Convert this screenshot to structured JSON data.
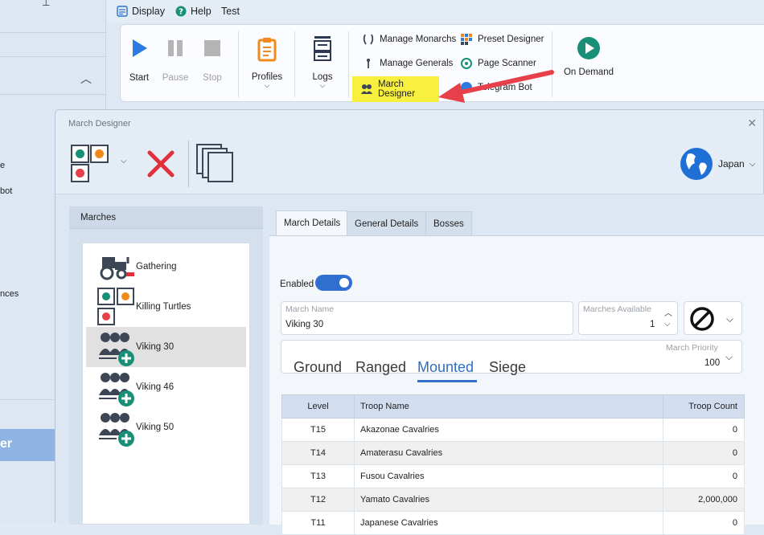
{
  "menu": {
    "display_label": "Display",
    "help_label": "Help",
    "test_label": "Test"
  },
  "ribbon": {
    "start_label": "Start",
    "pause_label": "Pause",
    "stop_label": "Stop",
    "profiles_label": "Profiles",
    "logs_label": "Logs",
    "manage_monarchs_label": "Manage Monarchs",
    "manage_generals_label": "Manage Generals",
    "march_designer_label": "March Designer",
    "preset_designer_label": "Preset Designer",
    "page_scanner_label": "Page Scanner",
    "telegram_bot_label": "Telegram Bot",
    "on_demand_label": "On Demand"
  },
  "left_pane": {
    "fragments": [
      "e",
      "bot",
      "nces"
    ],
    "selected_fragment": "er"
  },
  "dialog": {
    "title": "March Designer",
    "server_label": "Japan"
  },
  "marches": {
    "header": "Marches",
    "items": [
      {
        "label": "Gathering",
        "icon": "tractor-icon"
      },
      {
        "label": "Killing Turtles",
        "icon": "traffic-dots-icon"
      },
      {
        "label": "Viking 30",
        "icon": "troops-add-icon"
      },
      {
        "label": "Viking 46",
        "icon": "troops-add-icon"
      },
      {
        "label": "Viking 50",
        "icon": "troops-add-icon"
      }
    ]
  },
  "details": {
    "tabs": [
      "March Details",
      "General Details",
      "Bosses"
    ],
    "enabled_label": "Enabled",
    "march_name_label": "March Name",
    "march_name_value": "Viking 30",
    "marches_available_label": "Marches Available",
    "marches_available_value": "1",
    "march_priority_label": "March Priority",
    "march_priority_value": "100",
    "categories": [
      "Ground",
      "Ranged",
      "Mounted",
      "Siege"
    ],
    "active_category": "Mounted"
  },
  "troop_table": {
    "headers": [
      "Level",
      "Troop Name",
      "Troop Count"
    ],
    "rows": [
      {
        "level": "T15",
        "name": "Akazonae Cavalries",
        "count": "0"
      },
      {
        "level": "T14",
        "name": "Amaterasu Cavalries",
        "count": "0"
      },
      {
        "level": "T13",
        "name": "Fusou Cavalries",
        "count": "0"
      },
      {
        "level": "T12",
        "name": "Yamato Cavalries",
        "count": "2,000,000"
      },
      {
        "level": "T11",
        "name": "Japanese Cavalries",
        "count": "0"
      }
    ]
  },
  "colors": {
    "accent_blue": "#2f6fc8",
    "highlight_yellow": "#f7f03f",
    "arrow_red": "#e8404a",
    "on_demand_teal": "#1a8f78"
  }
}
